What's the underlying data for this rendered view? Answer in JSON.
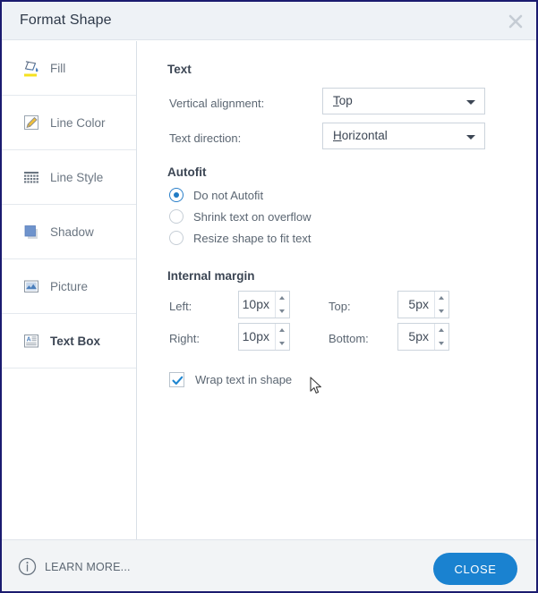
{
  "window": {
    "title": "Format Shape",
    "close_icon": "close-x-icon"
  },
  "sidebar": {
    "items": [
      {
        "label": "Fill",
        "icon": "paint-bucket-icon",
        "selected": false
      },
      {
        "label": "Line Color",
        "icon": "pencil-icon",
        "selected": false
      },
      {
        "label": "Line Style",
        "icon": "dashed-grid-icon",
        "selected": false
      },
      {
        "label": "Shadow",
        "icon": "shadow-square-icon",
        "selected": false
      },
      {
        "label": "Picture",
        "icon": "picture-frame-icon",
        "selected": false
      },
      {
        "label": "Text Box",
        "icon": "text-box-icon",
        "selected": true
      }
    ]
  },
  "main": {
    "text_section": {
      "heading": "Text",
      "vertical_alignment": {
        "label": "Vertical alignment:",
        "value": "Top",
        "accelerator": "T"
      },
      "text_direction": {
        "label": "Text direction:",
        "value": "Horizontal",
        "accelerator": "H"
      }
    },
    "autofit_section": {
      "heading": "Autofit",
      "options": [
        {
          "label": "Do not Autofit",
          "selected": true
        },
        {
          "label": "Shrink text on overflow",
          "selected": false
        },
        {
          "label": "Resize shape to fit text",
          "selected": false
        }
      ]
    },
    "internal_margin_section": {
      "heading": "Internal margin",
      "left": {
        "label": "Left:",
        "value": "10px"
      },
      "right": {
        "label": "Right:",
        "value": "10px"
      },
      "top": {
        "label": "Top:",
        "value": "5px"
      },
      "bottom": {
        "label": "Bottom:",
        "value": "5px"
      }
    },
    "wrap_text": {
      "label": "Wrap text in shape",
      "checked": true
    }
  },
  "footer": {
    "learn_more": "LEARN MORE...",
    "learn_more_icon": "info-circle-icon",
    "close_button": "CLOSE"
  },
  "colors": {
    "accent": "#1a82d0",
    "titlebar": "#eef2f6",
    "footer": "#f2f4f6",
    "border": "#1b1b6f",
    "text": "#3c4654"
  }
}
